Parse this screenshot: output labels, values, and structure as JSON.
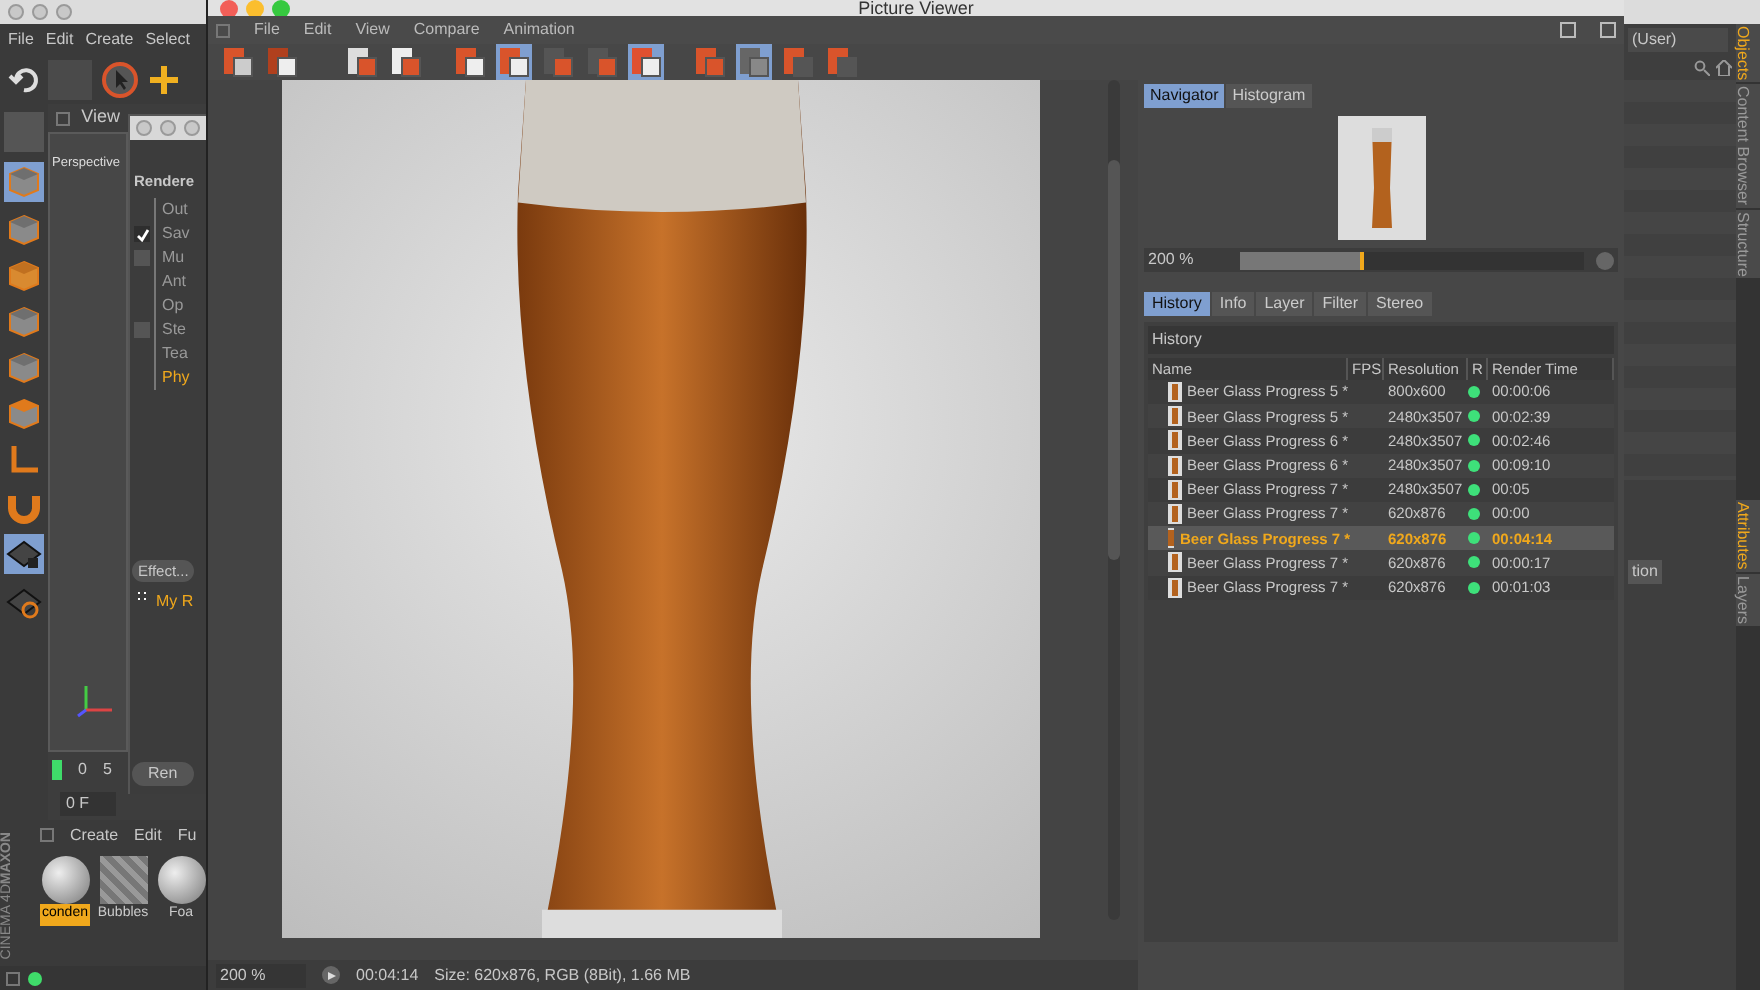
{
  "app": {
    "menu": [
      "File",
      "Edit",
      "Create",
      "Select"
    ],
    "view_menu": "View",
    "viewport_label": "Perspective",
    "render_settings": {
      "title": "Rendere",
      "items": [
        {
          "label": "Out",
          "kind": "plain",
          "selected": false
        },
        {
          "label": "Sav",
          "kind": "checkbox",
          "checked": true,
          "selected": false
        },
        {
          "label": "Mu",
          "kind": "checkbox",
          "checked": false,
          "selected": false
        },
        {
          "label": "Ant",
          "kind": "plain",
          "selected": false
        },
        {
          "label": "Op",
          "kind": "plain",
          "selected": false
        },
        {
          "label": "Ste",
          "kind": "checkbox",
          "checked": false,
          "selected": false
        },
        {
          "label": "Tea",
          "kind": "plain",
          "selected": false
        },
        {
          "label": "Phy",
          "kind": "plain",
          "selected": true
        }
      ],
      "effect_button": "Effect...",
      "tree_item": "My R",
      "render_button": "Ren"
    },
    "timeline": {
      "ticks": [
        "0",
        "5"
      ],
      "frame": "0 F"
    },
    "material_menu": [
      "Create",
      "Edit",
      "Fu"
    ],
    "materials": [
      {
        "name": "conden",
        "selected": true
      },
      {
        "name": "Bubbles",
        "selected": false
      },
      {
        "name": "Foa",
        "selected": false
      }
    ],
    "logo": [
      "MAXON",
      "CINEMA 4D"
    ],
    "layout_dropdown": "(User)",
    "side_tabs_top": [
      {
        "label": "Objects",
        "selected": true
      },
      {
        "label": "Content Browser",
        "selected": false
      },
      {
        "label": "Structure",
        "selected": false
      }
    ],
    "side_tabs_bottom": [
      {
        "label": "Attributes",
        "selected": true
      },
      {
        "label": "Layers",
        "selected": false
      }
    ],
    "attribute_button": "tion"
  },
  "viewer": {
    "title": "Picture Viewer",
    "menu": [
      "File",
      "Edit",
      "View",
      "Compare",
      "Animation"
    ],
    "navigator_tabs": [
      {
        "label": "Navigator",
        "selected": true
      },
      {
        "label": "Histogram",
        "selected": false
      }
    ],
    "zoom": "200 %",
    "zoom_slider": {
      "level": 0.36
    },
    "info_tabs": [
      {
        "label": "History",
        "selected": true
      },
      {
        "label": "Info",
        "selected": false
      },
      {
        "label": "Layer",
        "selected": false
      },
      {
        "label": "Filter",
        "selected": false
      },
      {
        "label": "Stereo",
        "selected": false
      }
    ],
    "history_title": "History",
    "columns": [
      "Name",
      "FPS",
      "Resolution",
      "R",
      "Render Time"
    ],
    "rows": [
      {
        "name": "Beer Glass Progress 5 *",
        "resolution": "800x600",
        "color": "#3ee07a",
        "time": "00:00:06",
        "selected": false
      },
      {
        "name": "Beer Glass Progress 5 *",
        "resolution": "2480x3507",
        "color": "#3ee07a",
        "time": "00:02:39",
        "selected": false
      },
      {
        "name": "Beer Glass Progress 6 *",
        "resolution": "2480x3507",
        "color": "#3ee07a",
        "time": "00:02:46",
        "selected": false
      },
      {
        "name": "Beer Glass Progress 6 *",
        "resolution": "2480x3507",
        "color": "#3ee07a",
        "time": "00:09:10",
        "selected": false
      },
      {
        "name": "Beer Glass Progress 7 *",
        "resolution": "2480x3507",
        "color": "#3ee07a",
        "time": "00:05",
        "selected": false
      },
      {
        "name": "Beer Glass Progress 7 *",
        "resolution": "620x876",
        "color": "#3ee07a",
        "time": "00:00",
        "selected": false
      },
      {
        "name": "Beer Glass Progress 7 *",
        "resolution": "620x876",
        "color": "#3ee07a",
        "time": "00:04:14",
        "selected": true
      },
      {
        "name": "Beer Glass Progress 7 *",
        "resolution": "620x876",
        "color": "#3ee07a",
        "time": "00:00:17",
        "selected": false
      },
      {
        "name": "Beer Glass Progress 7 *",
        "resolution": "620x876",
        "color": "#3ee07a",
        "time": "00:01:03",
        "selected": false
      }
    ],
    "status": {
      "zoom": "200 %",
      "time": "00:04:14",
      "size": "Size: 620x876, RGB (8Bit), 1.66 MB"
    }
  }
}
